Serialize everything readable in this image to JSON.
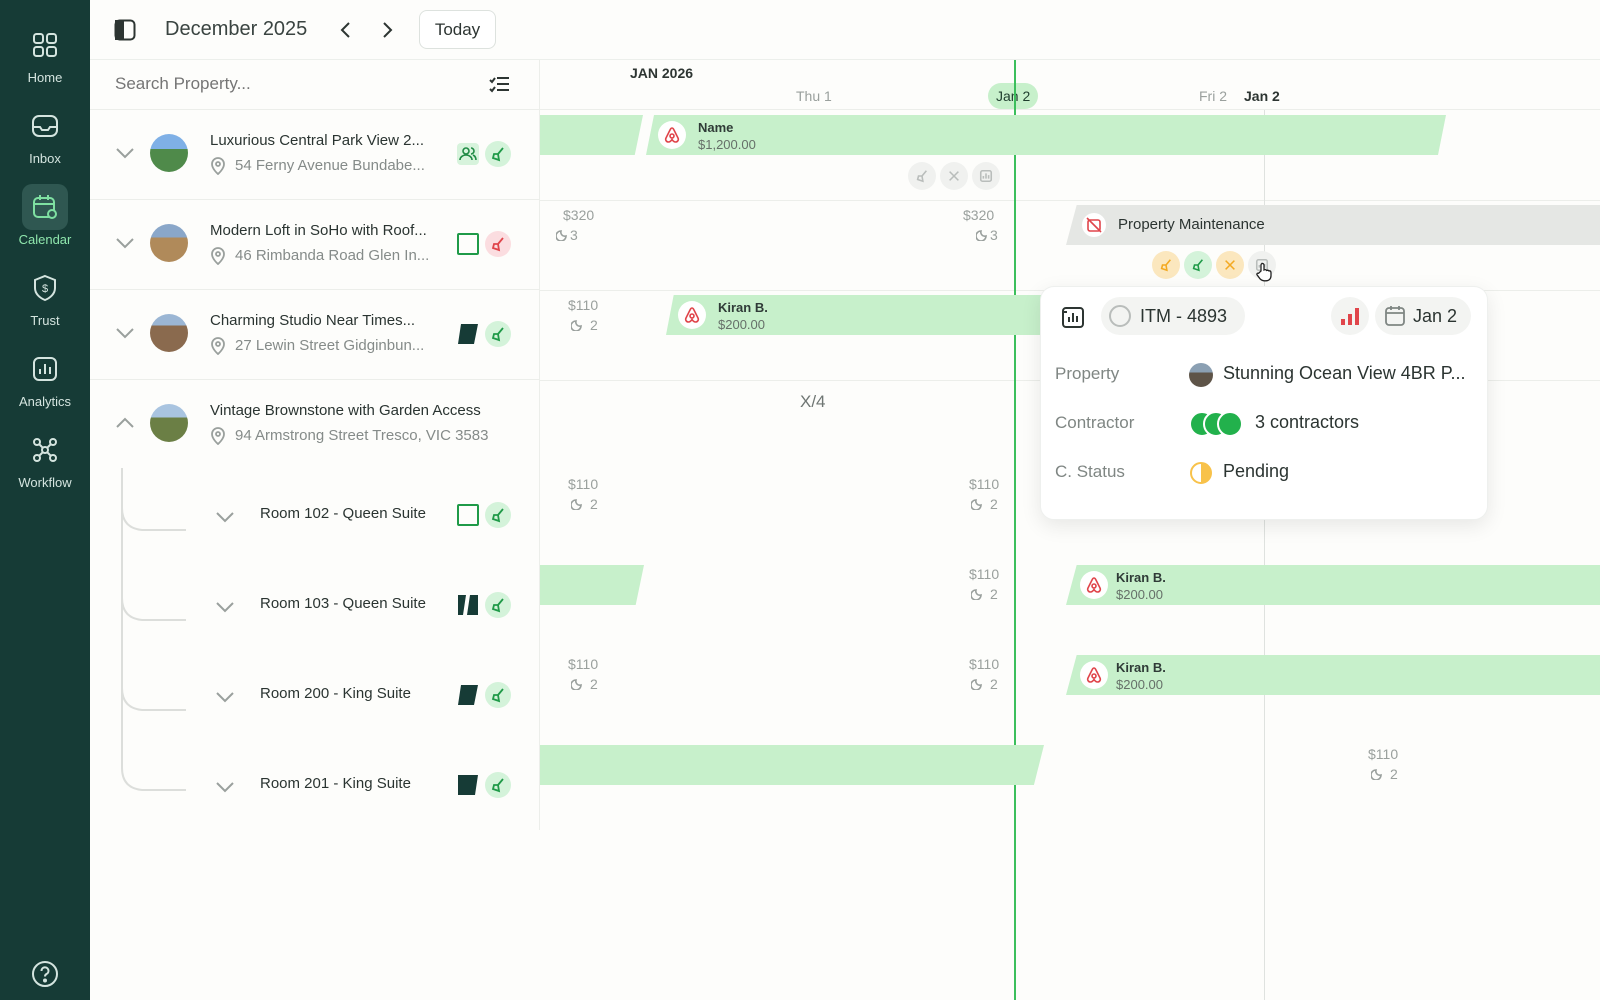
{
  "nav": {
    "items": [
      {
        "label": "Home",
        "icon": "grid-icon"
      },
      {
        "label": "Inbox",
        "icon": "inbox-icon"
      },
      {
        "label": "Calendar",
        "icon": "calendar-settings-icon"
      },
      {
        "label": "Trust",
        "icon": "shield-dollar-icon"
      },
      {
        "label": "Analytics",
        "icon": "bar-chart-icon"
      },
      {
        "label": "Workflow",
        "icon": "workflow-icon"
      }
    ],
    "active": "Calendar",
    "help_icon": "help-icon"
  },
  "header": {
    "month": "December 2025",
    "today_label": "Today"
  },
  "search": {
    "placeholder": "Search Property..."
  },
  "timeline": {
    "month_label": "JAN 2026",
    "days": [
      "Thu 1",
      "Jan 2",
      "Fri 2",
      "Jan 2"
    ]
  },
  "properties": [
    {
      "title": "Luxurious Central Park View 2...",
      "address": "54 Ferny Avenue Bundabe..."
    },
    {
      "title": "Modern Loft in SoHo with Roof...",
      "address": "46 Rimbanda Road Glen In..."
    },
    {
      "title": "Charming Studio Near Times...",
      "address": "27 Lewin Street Gidginbun..."
    },
    {
      "title": "Vintage Brownstone with Garden Access",
      "address": "94 Armstrong Street Tresco, VIC 3583"
    }
  ],
  "rooms": [
    {
      "label": "Room 102 - Queen Suite"
    },
    {
      "label": "Room 103 - Queen Suite"
    },
    {
      "label": "Room 200 - King Suite"
    },
    {
      "label": "Room 201 - King Suite"
    }
  ],
  "bookings": {
    "b1": {
      "name": "Name",
      "price": "$1,200.00"
    },
    "b2": {
      "name": "Kiran B.",
      "price": "$200.00"
    },
    "b3": {
      "name": "Kiran B.",
      "price": "$200.00"
    },
    "b4": {
      "name": "Kiran B.",
      "price": "$200.00"
    }
  },
  "maintenance": {
    "label": "Property Maintenance"
  },
  "rates": {
    "r320": "$320",
    "r110": "$110",
    "n3": "3",
    "n2": "2",
    "fraction": "X/4"
  },
  "popup": {
    "item_id": "ITM - 4893",
    "date": "Jan 2",
    "property_label": "Property",
    "property_value": "Stunning Ocean View 4BR P...",
    "contractor_label": "Contractor",
    "contractor_value": "3 contractors",
    "status_label": "C. Status",
    "status_value": "Pending"
  },
  "colors": {
    "sidebar": "#163b36",
    "booking": "#c7f0cb",
    "accent": "#22b14c",
    "today_line": "#3cbf5c",
    "pending": "#f8c24a",
    "alert": "#e0454b"
  }
}
